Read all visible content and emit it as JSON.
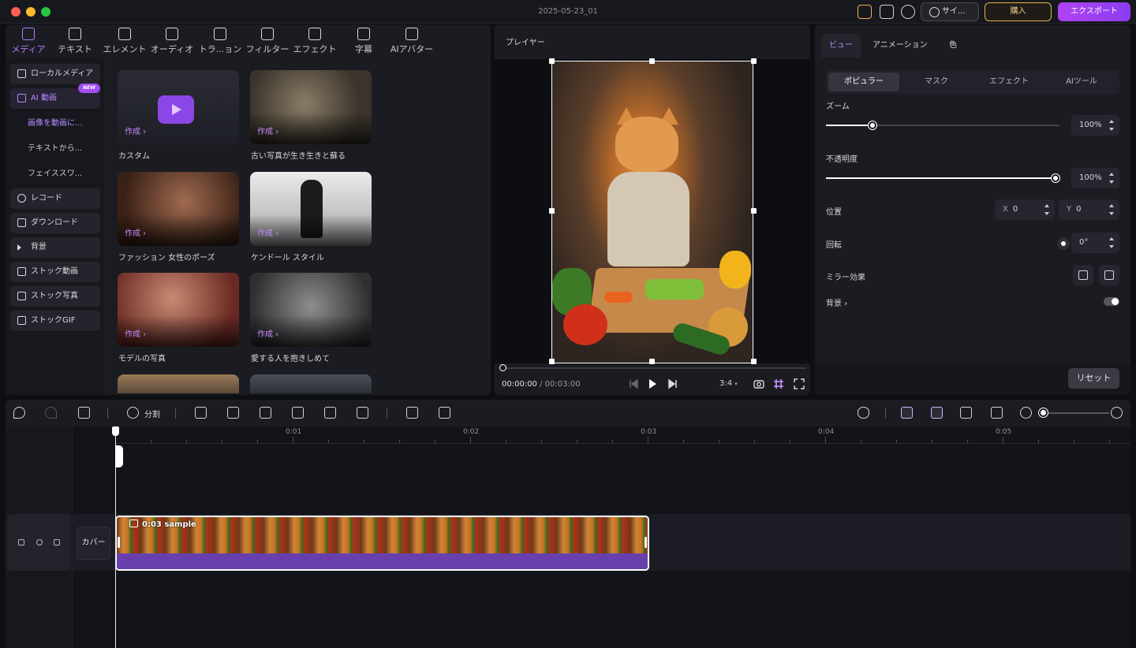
{
  "window": {
    "title": "2025-05-23_01"
  },
  "titlebar": {
    "signin_label": "サイ...",
    "buy_label": "購入",
    "export_label": "エクスポート"
  },
  "media_tabs": [
    {
      "label": "メディア",
      "icon": "media-icon",
      "active": true
    },
    {
      "label": "テキスト",
      "icon": "text-icon"
    },
    {
      "label": "エレメント",
      "icon": "element-icon"
    },
    {
      "label": "オーディオ",
      "icon": "audio-icon"
    },
    {
      "label": "トラ...ョン",
      "icon": "transition-icon"
    },
    {
      "label": "フィルター",
      "icon": "filter-icon"
    },
    {
      "label": "エフェクト",
      "icon": "effect-icon"
    },
    {
      "label": "字幕",
      "icon": "subtitle-icon"
    },
    {
      "label": "AIアバター",
      "icon": "ai-avatar-icon"
    }
  ],
  "sidebar": {
    "items": [
      {
        "label": "ローカルメディア",
        "icon": "folder-icon"
      },
      {
        "label": "AI 動画",
        "icon": "ai-video-icon",
        "active": true,
        "badge": "NEW"
      },
      {
        "label": "画像を動画に...",
        "sub": true,
        "active": true
      },
      {
        "label": "テキストから...",
        "sub": true
      },
      {
        "label": "フェイススワ...",
        "sub": true
      },
      {
        "label": "レコード",
        "icon": "record-icon"
      },
      {
        "label": "ダウンロード",
        "icon": "download-icon"
      },
      {
        "label": "背景",
        "icon": "background-icon"
      },
      {
        "label": "ストック動画",
        "icon": "stock-video-icon"
      },
      {
        "label": "ストック写真",
        "icon": "stock-photo-icon"
      },
      {
        "label": "ストックGIF",
        "icon": "gif-icon"
      }
    ]
  },
  "templates": {
    "make_label": "作成 ›",
    "cards": [
      {
        "label": "カスタム"
      },
      {
        "label": "古い写真が生き生きと蘇る"
      },
      {
        "label": "ファッション 女性のポーズ"
      },
      {
        "label": "ケンドール スタイル"
      },
      {
        "label": "モデルの写真"
      },
      {
        "label": "愛する人を抱きしめて"
      }
    ]
  },
  "player": {
    "title": "プレイヤー",
    "current_time": "00:00:00",
    "separator": " / ",
    "duration": "00:03:00",
    "aspect_ratio": "3:4"
  },
  "properties": {
    "tabs": [
      "ビュー",
      "アニメーション",
      "色"
    ],
    "segments": [
      "ポピュラー",
      "マスク",
      "エフェクト",
      "AIツール"
    ],
    "zoom": {
      "label": "ズーム",
      "value": "100%",
      "fraction": 0.2
    },
    "opacity": {
      "label": "不透明度",
      "value": "100%",
      "fraction": 1.0
    },
    "position": {
      "label": "位置",
      "x_label": "X",
      "x": "0",
      "y_label": "Y",
      "y": "0"
    },
    "rotation": {
      "label": "回転",
      "value": "0°"
    },
    "mirror": {
      "label": "ミラー効果"
    },
    "background": {
      "label": "背景 ›"
    },
    "reset_label": "リセット"
  },
  "timeline": {
    "split_label": "分割",
    "ticks": [
      "0:01",
      "0:02",
      "0:03",
      "0:04",
      "0:05"
    ],
    "cover_label": "カバー",
    "clip": {
      "label": "0:03 sample"
    }
  }
}
